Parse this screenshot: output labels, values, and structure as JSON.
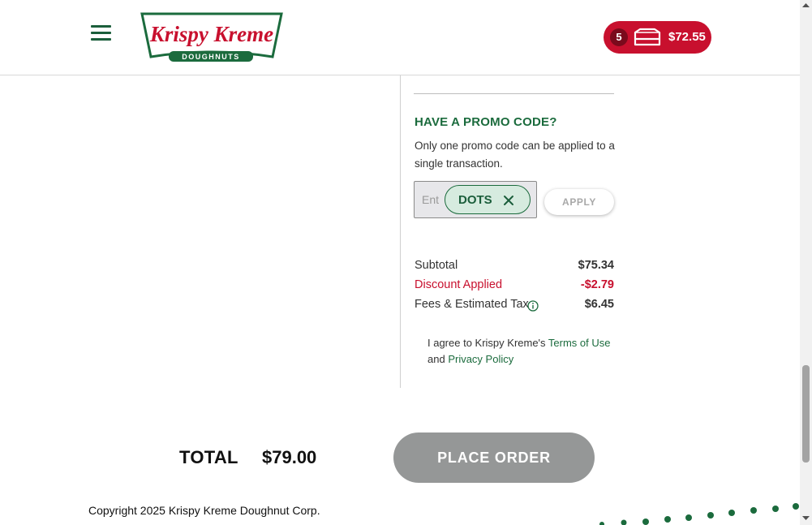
{
  "header": {
    "logo_text": "Krispy Kreme",
    "logo_subtext": "DOUGHNUTS",
    "cart": {
      "count": "5",
      "total": "$72.55"
    }
  },
  "promo": {
    "title": "HAVE A PROMO CODE?",
    "description": "Only one promo code can be applied to a single transaction.",
    "placeholder": "Ent",
    "applied_code": "DOTS",
    "apply_label": "APPLY"
  },
  "summary": {
    "subtotal_label": "Subtotal",
    "subtotal_value": "$75.34",
    "discount_label": "Discount Applied",
    "discount_value": "-$2.79",
    "fees_label": "Fees & Estimated Tax",
    "fees_value": "$6.45"
  },
  "agreement": {
    "prefix": "I agree to Krispy Kreme's ",
    "terms_link": "Terms of Use",
    "middle": "and ",
    "privacy_link": "Privacy Policy"
  },
  "totals": {
    "label": "TOTAL",
    "value": "$79.00",
    "place_order_label": "PLACE ORDER"
  },
  "footer": {
    "copyright": "Copyright 2025 Krispy Kreme Doughnut Corp."
  },
  "colors": {
    "brand_red": "#c8102e",
    "brand_green": "#1b6b3d",
    "disabled_gray": "#959797"
  },
  "icons": [
    "menu-icon",
    "cart-box-icon",
    "close-icon",
    "info-icon",
    "scroll-up-arrow-icon",
    "scroll-down-arrow-icon"
  ]
}
